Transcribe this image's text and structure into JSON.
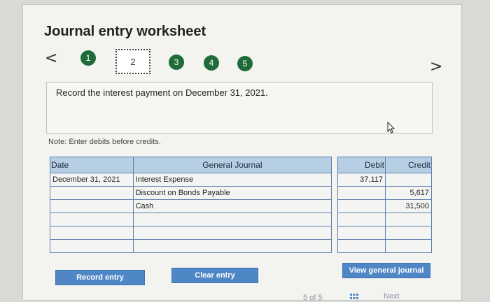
{
  "header": {
    "title": "Journal entry worksheet"
  },
  "nav": {
    "prev_icon": "chevron-left-icon",
    "next_icon": "chevron-right-icon",
    "prev_glyph": "<",
    "next_glyph": ">",
    "steps": [
      "1",
      "2",
      "3",
      "4",
      "5"
    ],
    "current_step": "2"
  },
  "prompt": {
    "text": "Record the interest payment on December 31, 2021."
  },
  "note": "Note: Enter debits before credits.",
  "journal": {
    "headers": {
      "date": "Date",
      "account": "General Journal",
      "debit": "Debit",
      "credit": "Credit"
    },
    "rows": [
      {
        "date": "December 31, 2021",
        "account": "Interest Expense",
        "debit": "37,117",
        "credit": ""
      },
      {
        "date": "",
        "account": "Discount on Bonds Payable",
        "debit": "",
        "credit": "5,617"
      },
      {
        "date": "",
        "account": "Cash",
        "debit": "",
        "credit": "31,500"
      },
      {
        "date": "",
        "account": "",
        "debit": "",
        "credit": ""
      },
      {
        "date": "",
        "account": "",
        "debit": "",
        "credit": ""
      },
      {
        "date": "",
        "account": "",
        "debit": "",
        "credit": ""
      }
    ]
  },
  "buttons": {
    "record": "Record entry",
    "clear": "Clear entry",
    "view": "View general journal"
  },
  "footer": {
    "page": "5 of 5",
    "next": "Next"
  },
  "colors": {
    "accent": "#4f86c6",
    "step": "#1f6b3a",
    "header_bg": "#b7cfe4"
  }
}
